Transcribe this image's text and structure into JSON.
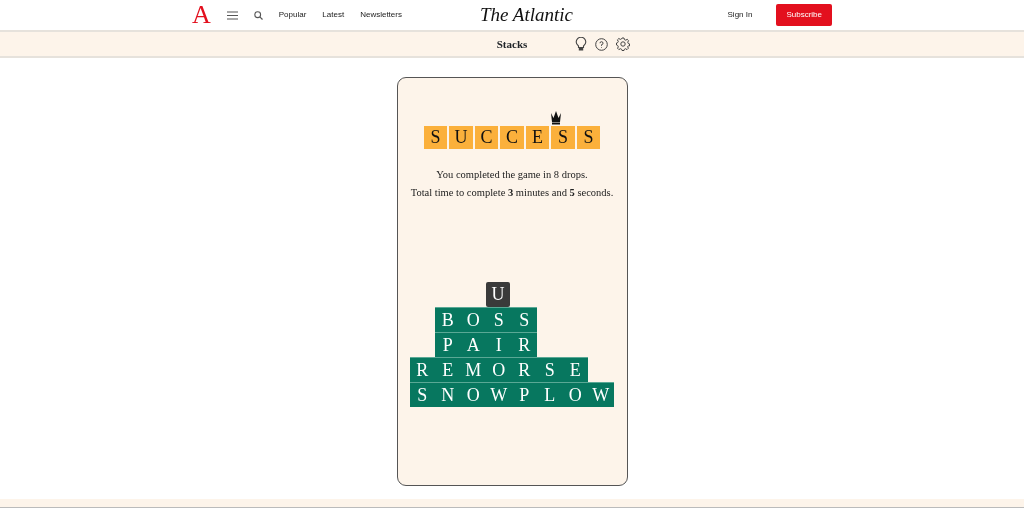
{
  "header": {
    "logo_mark": "A",
    "nav_links": [
      "Popular",
      "Latest",
      "Newsletters"
    ],
    "logo": "The Atlantic",
    "sign_in": "Sign In",
    "subscribe": "Subscribe"
  },
  "subbar": {
    "title": "Stacks"
  },
  "game": {
    "result_letters": [
      "S",
      "U",
      "C",
      "C",
      "E",
      "S",
      "S"
    ],
    "message": [
      "You completed the game in 8 drops.",
      "Total time to complete **3** minutes and **5** seconds."
    ],
    "stack": [
      {
        "kind": "falling",
        "letters": [
          "U"
        ]
      },
      {
        "kind": "placed",
        "letters": [
          "B",
          "O",
          "S",
          "S"
        ]
      },
      {
        "kind": "placed",
        "letters": [
          "P",
          "A",
          "I",
          "R"
        ]
      },
      {
        "kind": "placed",
        "letters": [
          "R",
          "E",
          "M",
          "O",
          "R",
          "S",
          "E"
        ]
      },
      {
        "kind": "placed",
        "letters": [
          "S",
          "N",
          "O",
          "W",
          "P",
          "L",
          "O",
          "W"
        ]
      }
    ]
  }
}
